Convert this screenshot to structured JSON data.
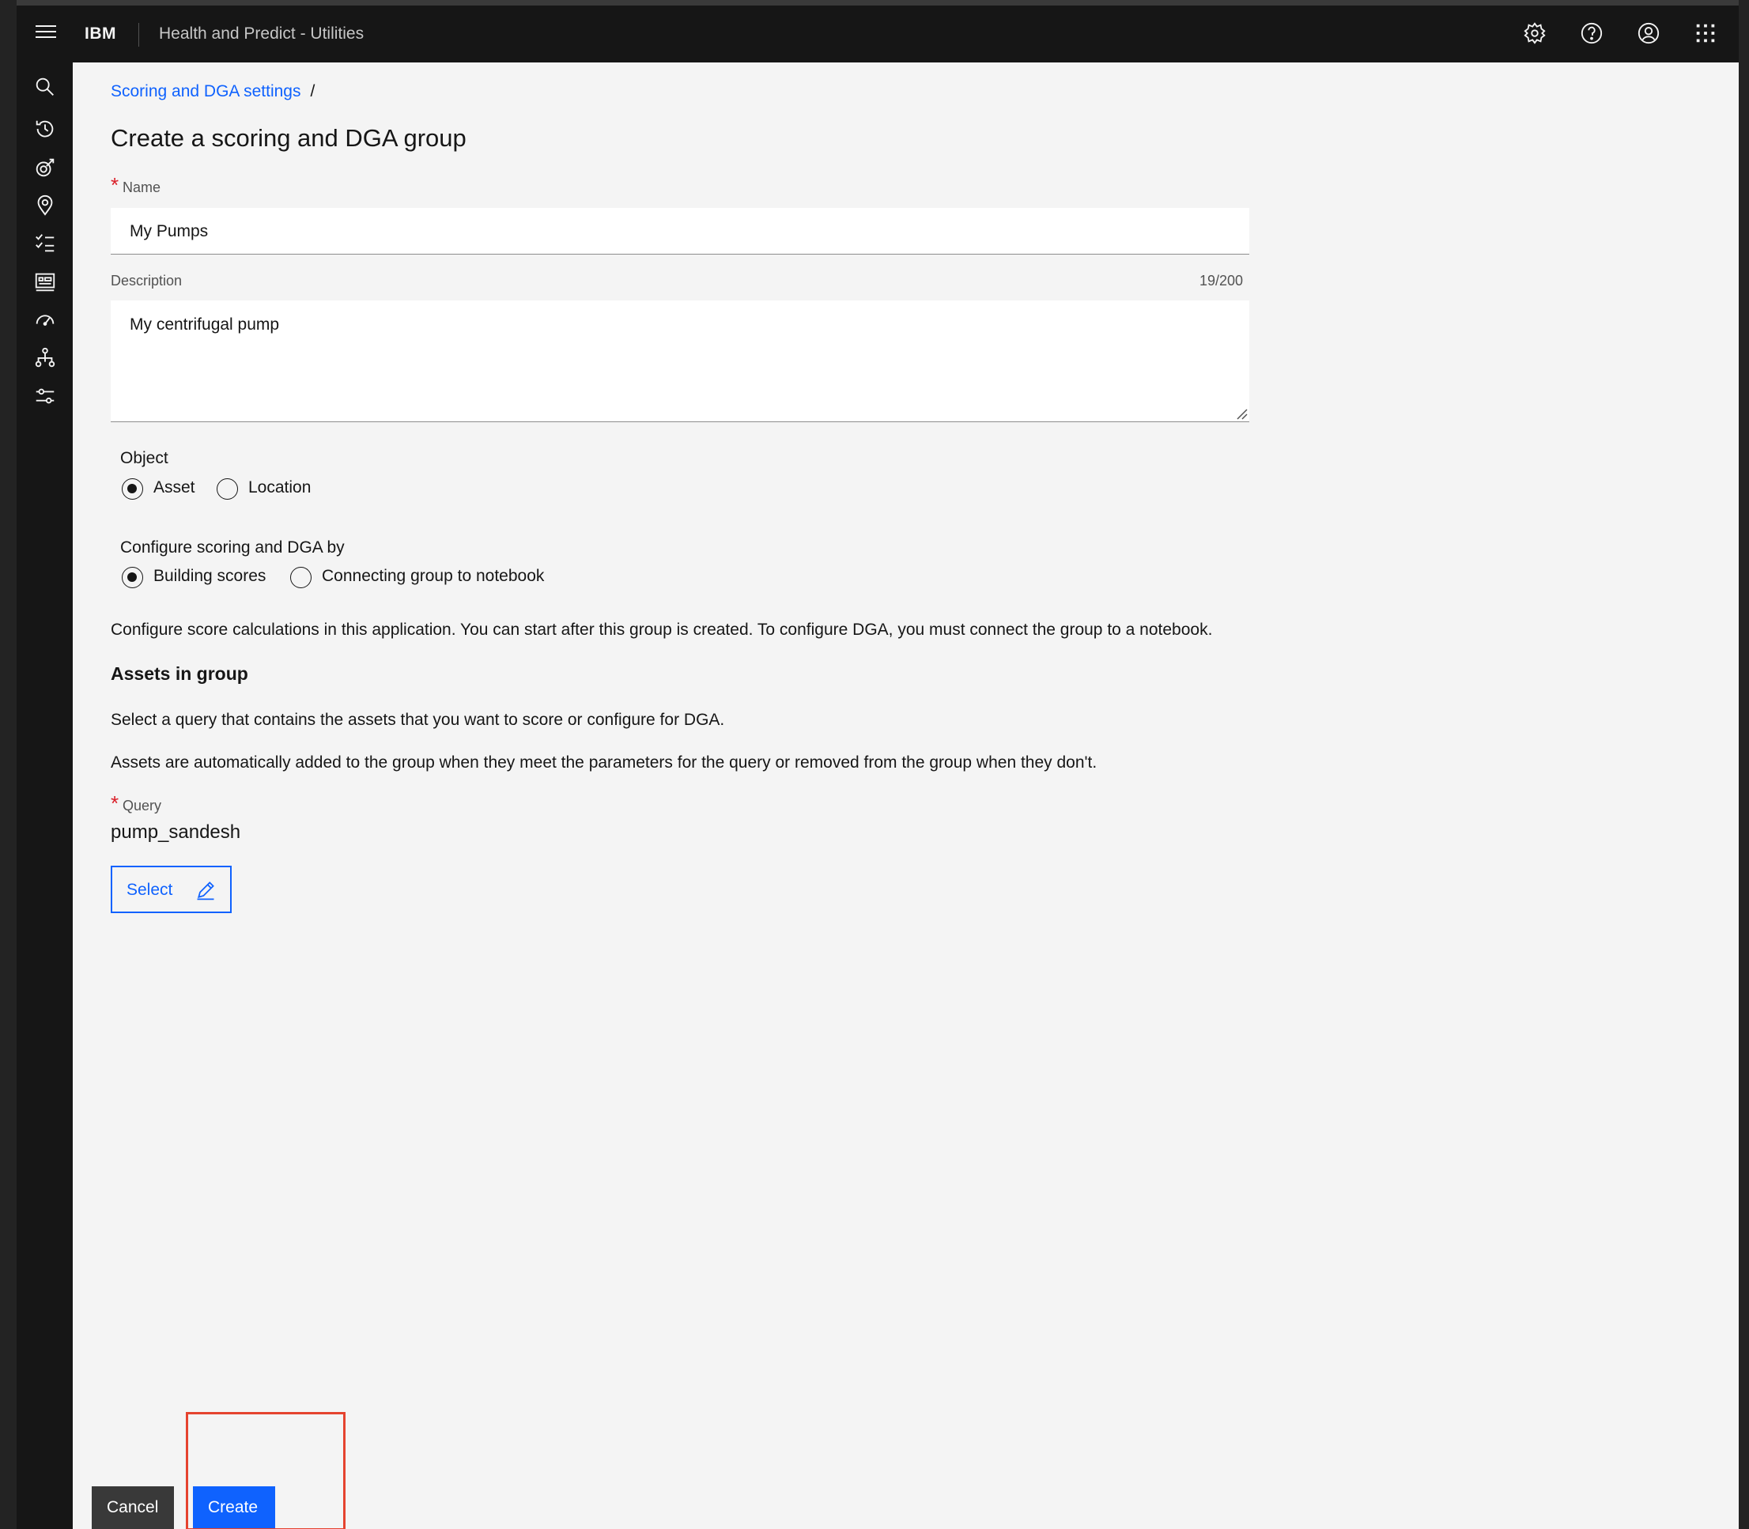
{
  "header": {
    "brand": "IBM",
    "app_title": "Health and Predict - Utilities",
    "icons": [
      "menu-icon",
      "settings-icon",
      "help-icon",
      "user-profile-icon",
      "app-switcher-icon"
    ]
  },
  "sidenav": {
    "icons": [
      "search-icon",
      "history-icon",
      "asset-tracking-icon",
      "location-icon",
      "checklist-icon",
      "dashboard-icon",
      "gauge-icon",
      "hierarchy-icon",
      "sliders-icon"
    ]
  },
  "breadcrumb": {
    "link": "Scoring and DGA settings",
    "separator": "/"
  },
  "page_title": "Create a scoring and DGA group",
  "name_field": {
    "label": "Name",
    "value": "My Pumps",
    "required": true
  },
  "description_field": {
    "label": "Description",
    "value": "My centrifugal pump",
    "counter": "19/200"
  },
  "object_group": {
    "label": "Object",
    "options": [
      {
        "label": "Asset",
        "selected": true
      },
      {
        "label": "Location",
        "selected": false
      }
    ]
  },
  "configure_group": {
    "label": "Configure scoring and DGA by",
    "options": [
      {
        "label": "Building scores",
        "selected": true
      },
      {
        "label": "Connecting group to notebook",
        "selected": false
      }
    ]
  },
  "configure_help": "Configure score calculations in this application. You can start after this group is created. To configure DGA, you must connect the group to a notebook.",
  "assets_section": {
    "heading": "Assets in group",
    "para1": "Select a query that contains the assets that you want to score or configure for DGA.",
    "para2": "Assets are automatically added to the group when they meet the parameters for the query or removed from the group when they don't."
  },
  "query": {
    "label": "Query",
    "value": "pump_sandesh",
    "select_label": "Select",
    "required": true
  },
  "footer": {
    "cancel_label": "Cancel",
    "create_label": "Create"
  },
  "colors": {
    "accent": "#0f62fe",
    "required": "#da1e28",
    "highlight": "#e5432f",
    "shell": "#161616"
  }
}
